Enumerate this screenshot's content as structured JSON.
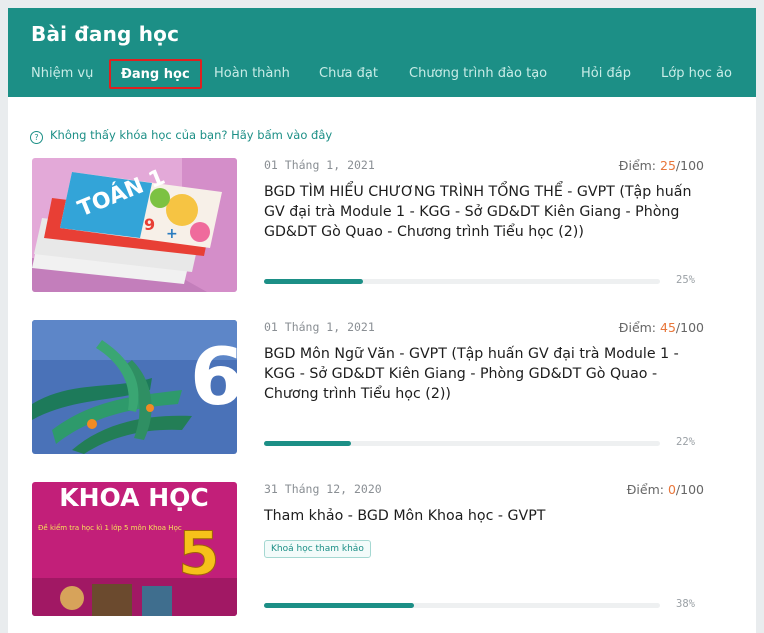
{
  "header": {
    "title": "Bài đang học",
    "tabs": [
      {
        "label": "Nhiệm vụ",
        "active": false
      },
      {
        "label": "Đang học",
        "active": true
      },
      {
        "label": "Hoàn thành",
        "active": false
      },
      {
        "label": "Chưa đạt",
        "active": false
      },
      {
        "label": "Chương trình đào tạo",
        "active": false
      },
      {
        "label": "Hỏi đáp",
        "active": false
      },
      {
        "label": "Lớp học ảo",
        "active": false
      }
    ]
  },
  "help": {
    "icon": "question-circle-icon",
    "text": "Không thấy khóa học của bạn? Hãy bấm vào đây"
  },
  "courses": [
    {
      "date": "01 Tháng 1, 2021",
      "score_label": "Điểm:",
      "score": "25",
      "score_max": "/100",
      "title": "BGD TÌM HIỂU CHƯƠNG TRÌNH TỔNG THỂ - GVPT (Tập huấn GV đại trà Module 1 - KGG - Sở GD&DT Kiên Giang - Phòng GD&DT Gò Quao - Chương trình Tiểu học (2))",
      "progress": 25,
      "progress_label": "25%",
      "thumb": {
        "type": "toan-books",
        "text": "TOÁN 1"
      }
    },
    {
      "date": "01 Tháng 1, 2021",
      "score_label": "Điểm:",
      "score": "45",
      "score_max": "/100",
      "title": "BGD Môn Ngữ Văn - GVPT (Tập huấn GV đại trà Module 1 - KGG - Sở GD&DT Kiên Giang - Phòng GD&DT Gò Quao - Chương trình Tiểu học (2))",
      "progress": 22,
      "progress_label": "22%",
      "thumb": {
        "type": "leaves",
        "text": "6"
      }
    },
    {
      "date": "31 Tháng 12, 2020",
      "score_label": "Điểm:",
      "score": "0",
      "score_max": "/100",
      "title": "Tham khảo - BGD Môn Khoa học - GVPT",
      "badge": "Khoá học tham khảo",
      "progress": 38,
      "progress_label": "38%",
      "thumb": {
        "type": "khoa-hoc",
        "text": "KHOA HỌC",
        "subtext": "Đề kiểm tra học kì 1 lớp 5 môn Khoa Học",
        "number": "5"
      }
    }
  ],
  "colors": {
    "accent": "#1c8f86",
    "score": "#e8763a",
    "active_tab_outline": "#e02020"
  }
}
